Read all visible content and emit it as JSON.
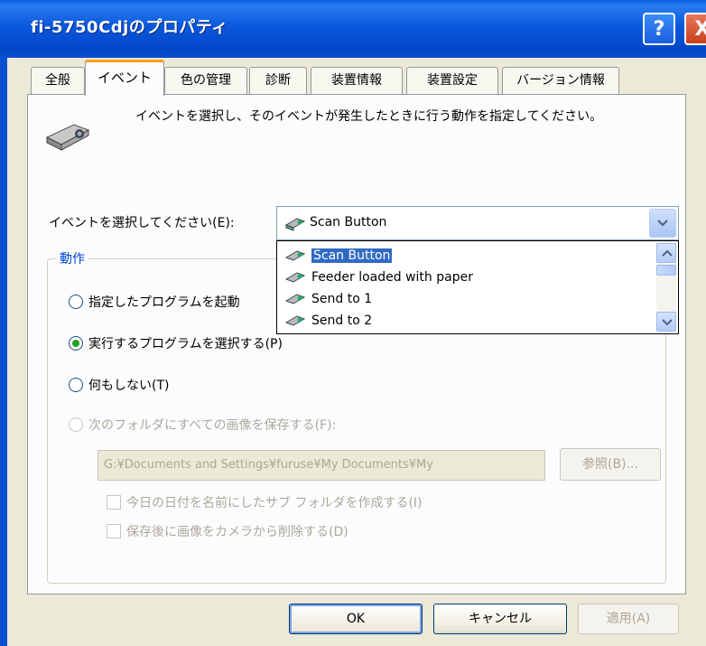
{
  "window": {
    "title": "fi-5750Cdjのプロパティ",
    "help_label": "?",
    "close_label": "X"
  },
  "tabs": [
    {
      "label": "全般"
    },
    {
      "label": "イベント"
    },
    {
      "label": "色の管理"
    },
    {
      "label": "診断"
    },
    {
      "label": "装置情報"
    },
    {
      "label": "装置設定"
    },
    {
      "label": "バージョン情報"
    }
  ],
  "active_tab": "イベント",
  "description": "イベントを選択し、そのイベントが発生したときに行う動作を指定してください。",
  "event_select": {
    "label": "イベントを選択してください(E):",
    "value": "Scan Button",
    "options": [
      "Scan Button",
      "Feeder loaded with paper",
      "Send to 1",
      "Send to 2"
    ]
  },
  "actions": {
    "legend": "動作",
    "radio_launch": "指定したプログラムを起動",
    "radio_choose": "実行するプログラムを選択する(P)",
    "radio_none": "何もしない(T)",
    "radio_save": "次のフォルダにすべての画像を保存する(F):",
    "selected": "radio_choose",
    "folder_path": "G:¥Documents and Settings¥furuse¥My Documents¥My",
    "browse_label": "参照(B)...",
    "check_subfolder": "今日の日付を名前にしたサブ フォルダを作成する(I)",
    "check_delete": "保存後に画像をカメラから削除する(D)"
  },
  "buttons": {
    "ok": "OK",
    "cancel": "キャンセル",
    "apply": "適用(A)"
  },
  "colors": {
    "title_bar": "#0a58dc",
    "tab_accent": "#ff9c00",
    "selection": "#316ac5",
    "group_legend": "#0046d5"
  }
}
